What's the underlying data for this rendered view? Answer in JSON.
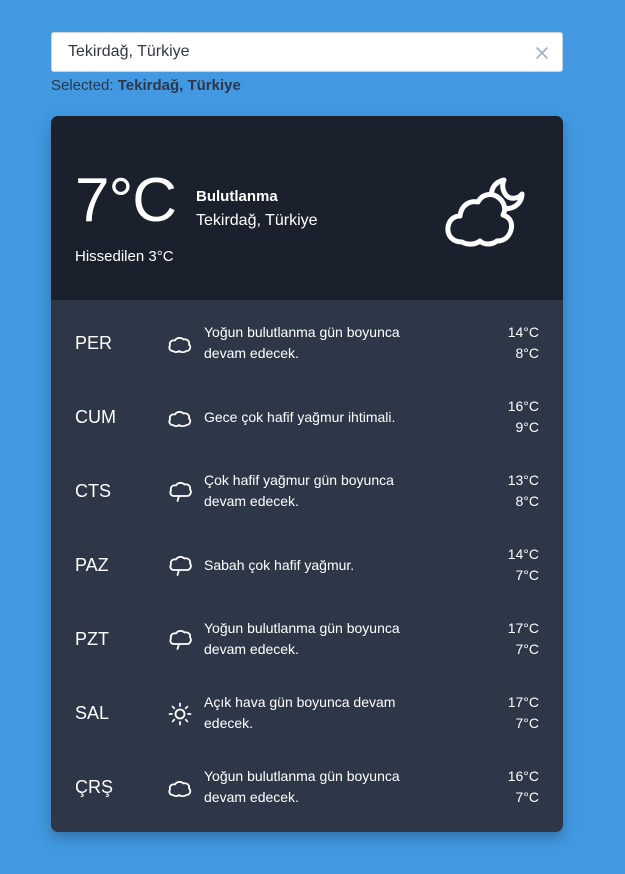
{
  "search": {
    "value": "Tekirdağ, Türkiye",
    "placeholder": "",
    "clear_icon": "close-icon"
  },
  "selected": {
    "prefix": "Selected:",
    "value": "Tekirdağ, Türkiye"
  },
  "current": {
    "temperature": "7°C",
    "feels_like": "Hissedilen 3°C",
    "condition": "Bulutlanma",
    "location": "Tekirdağ, Türkiye",
    "icon": "partly-cloudy-night-icon"
  },
  "forecast": [
    {
      "day": "PER",
      "icon": "cloud-icon",
      "description": "Yoğun bulutlanma gün boyunca devam edecek.",
      "high": "14°C",
      "low": "8°C"
    },
    {
      "day": "CUM",
      "icon": "cloud-icon",
      "description": "Gece çok hafif yağmur ihtimali.",
      "high": "16°C",
      "low": "9°C"
    },
    {
      "day": "CTS",
      "icon": "rain-cloud-icon",
      "description": "Çok hafif yağmur gün boyunca devam edecek.",
      "high": "13°C",
      "low": "8°C"
    },
    {
      "day": "PAZ",
      "icon": "rain-cloud-icon",
      "description": "Sabah çok hafif yağmur.",
      "high": "14°C",
      "low": "7°C"
    },
    {
      "day": "PZT",
      "icon": "rain-cloud-icon",
      "description": "Yoğun bulutlanma gün boyunca devam edecek.",
      "high": "17°C",
      "low": "7°C"
    },
    {
      "day": "SAL",
      "icon": "sun-icon",
      "description": "Açık hava gün boyunca devam edecek.",
      "high": "17°C",
      "low": "7°C"
    },
    {
      "day": "ÇRŞ",
      "icon": "cloud-icon",
      "description": "Yoğun bulutlanma gün boyunca devam edecek.",
      "high": "16°C",
      "low": "7°C"
    }
  ],
  "colors": {
    "background": "#4299e1",
    "current_panel": "#1a202c",
    "forecast_panel": "#2d3748"
  }
}
